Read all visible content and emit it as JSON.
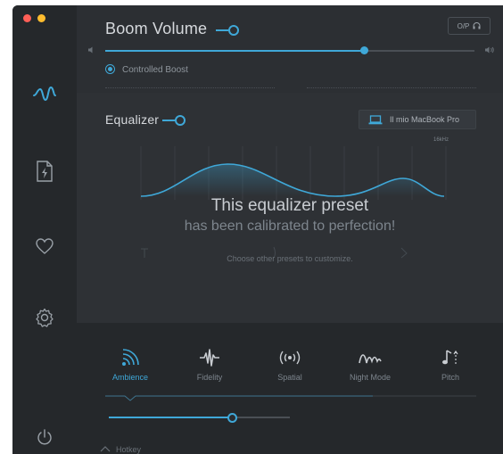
{
  "window": {
    "traffic_lights": {
      "close_color": "#ff5f57",
      "minimize_color": "#febc2e"
    }
  },
  "sidebar": {
    "items": [
      {
        "icon": "wave-icon",
        "active": true
      },
      {
        "icon": "file-bolt-icon",
        "active": false
      },
      {
        "icon": "heart-icon",
        "active": false
      },
      {
        "icon": "gear-icon",
        "active": false
      },
      {
        "icon": "power-icon",
        "active": false
      }
    ]
  },
  "volume": {
    "title": "Boom Volume",
    "output_button": "O/P",
    "level": 0.7,
    "controlled_boost_label": "Controlled Boost"
  },
  "equalizer": {
    "title": "Equalizer",
    "device": "Il mio MacBook Pro",
    "freq_label": "16kHz",
    "message_line1": "This equalizer preset",
    "message_line2": "has been calibrated to perfection!",
    "hint": "Choose other presets to customize."
  },
  "modes": {
    "items": [
      {
        "label": "Ambience",
        "icon": "ambience-icon",
        "active": true
      },
      {
        "label": "Fidelity",
        "icon": "fidelity-icon",
        "active": false
      },
      {
        "label": "Spatial",
        "icon": "spatial-icon",
        "active": false
      },
      {
        "label": "Night Mode",
        "icon": "night-mode-icon",
        "active": false
      },
      {
        "label": "Pitch",
        "icon": "pitch-icon",
        "active": false
      }
    ],
    "intensity": 0.68
  },
  "hotkey": {
    "label": "Hotkey"
  },
  "colors": {
    "accent": "#3fa8d8",
    "background": "#2a2d31",
    "sidebar": "#25282b"
  }
}
